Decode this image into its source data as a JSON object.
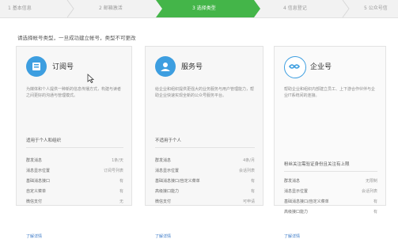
{
  "steps": [
    {
      "label": "1 基本信息"
    },
    {
      "label": "2 邮箱激活"
    },
    {
      "label": "3 选择类型"
    },
    {
      "label": "4 信息登记"
    },
    {
      "label": "5 公众号信"
    }
  ],
  "colors": {
    "accent": "#44b549",
    "icon_blue": "#3d9ee0",
    "link": "#3d7bc8"
  },
  "instruction": "请选择帐号类型，一旦成功建立帐号，类型不可更改",
  "cards": [
    {
      "title": "订阅号",
      "icon": "subscription-icon",
      "desc": "为媒体和个人提供一种新的信息传播方式，构建与读者之间更好的沟通与管理模式。",
      "target": "适用于个人和组织",
      "features": [
        {
          "k": "群发消息",
          "v": "1条/天"
        },
        {
          "k": "消息显示位置",
          "v": "订阅号列表"
        },
        {
          "k": "基础消息接口",
          "v": "有"
        },
        {
          "k": "自定义菜单",
          "v": "有"
        },
        {
          "k": "微信支付",
          "v": "无"
        }
      ],
      "more": "了解详情"
    },
    {
      "title": "服务号",
      "icon": "service-icon",
      "desc": "给企业和组织提供更强大的业务服务与用户管理能力，帮助企业快速实现全新的公众号服务平台。",
      "target": "不适用于个人",
      "features": [
        {
          "k": "群发消息",
          "v": "4条/月"
        },
        {
          "k": "消息显示位置",
          "v": "会话列表"
        },
        {
          "k": "基础消息接口/自定义菜单",
          "v": "有"
        },
        {
          "k": "高级接口能力",
          "v": "有"
        },
        {
          "k": "微信支付",
          "v": "可申请"
        }
      ],
      "more": "了解详情"
    },
    {
      "title": "企业号",
      "icon": "enterprise-icon",
      "desc": "帮助企业和组织内部建立员工、上下游合作伙伴与企业IT系统间的连接。",
      "target": "粉丝关注需验证身份且关注有上限",
      "features": [
        {
          "k": "群发消息",
          "v": "无限制"
        },
        {
          "k": "消息显示位置",
          "v": "会话列表"
        },
        {
          "k": "基础消息接口/自定义菜单",
          "v": "有"
        },
        {
          "k": "高级接口能力",
          "v": "有"
        }
      ],
      "more": "了解详情"
    }
  ]
}
